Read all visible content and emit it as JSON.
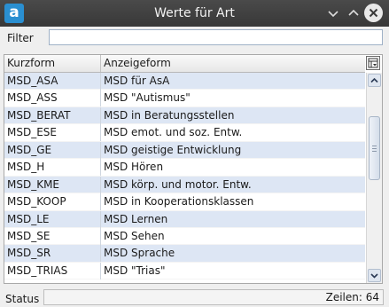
{
  "window": {
    "app_icon_letter": "a",
    "title": "Werte für Art",
    "buttons": [
      "minimize-icon",
      "maximize-icon",
      "close-icon"
    ]
  },
  "filter": {
    "label": "Filter",
    "value": ""
  },
  "table": {
    "columns": [
      "Kurzform",
      "Anzeigeform"
    ],
    "rows": [
      [
        "MSD_ASA",
        "MSD für AsA"
      ],
      [
        "MSD_ASS",
        "MSD \"Autismus\""
      ],
      [
        "MSD_BERAT",
        "MSD in Beratungsstellen"
      ],
      [
        "MSD_ESE",
        "MSD emot. und soz. Entw."
      ],
      [
        "MSD_GE",
        "MSD geistige Entwicklung"
      ],
      [
        "MSD_H",
        "MSD Hören"
      ],
      [
        "MSD_KME",
        "MSD körp. und motor. Entw."
      ],
      [
        "MSD_KOOP",
        "MSD in Kooperationsklassen"
      ],
      [
        "MSD_LE",
        "MSD Lernen"
      ],
      [
        "MSD_SE",
        "MSD Sehen"
      ],
      [
        "MSD_SR",
        "MSD Sprache"
      ],
      [
        "MSD_TRIAS",
        "MSD \"Trias\""
      ]
    ]
  },
  "status": {
    "label": "Status",
    "count_text": "Zeilen: 64"
  },
  "colors": {
    "titlebar": "#3e3e3e",
    "row_alt": "#dde6f4",
    "app_icon": "#2a8fd1"
  }
}
